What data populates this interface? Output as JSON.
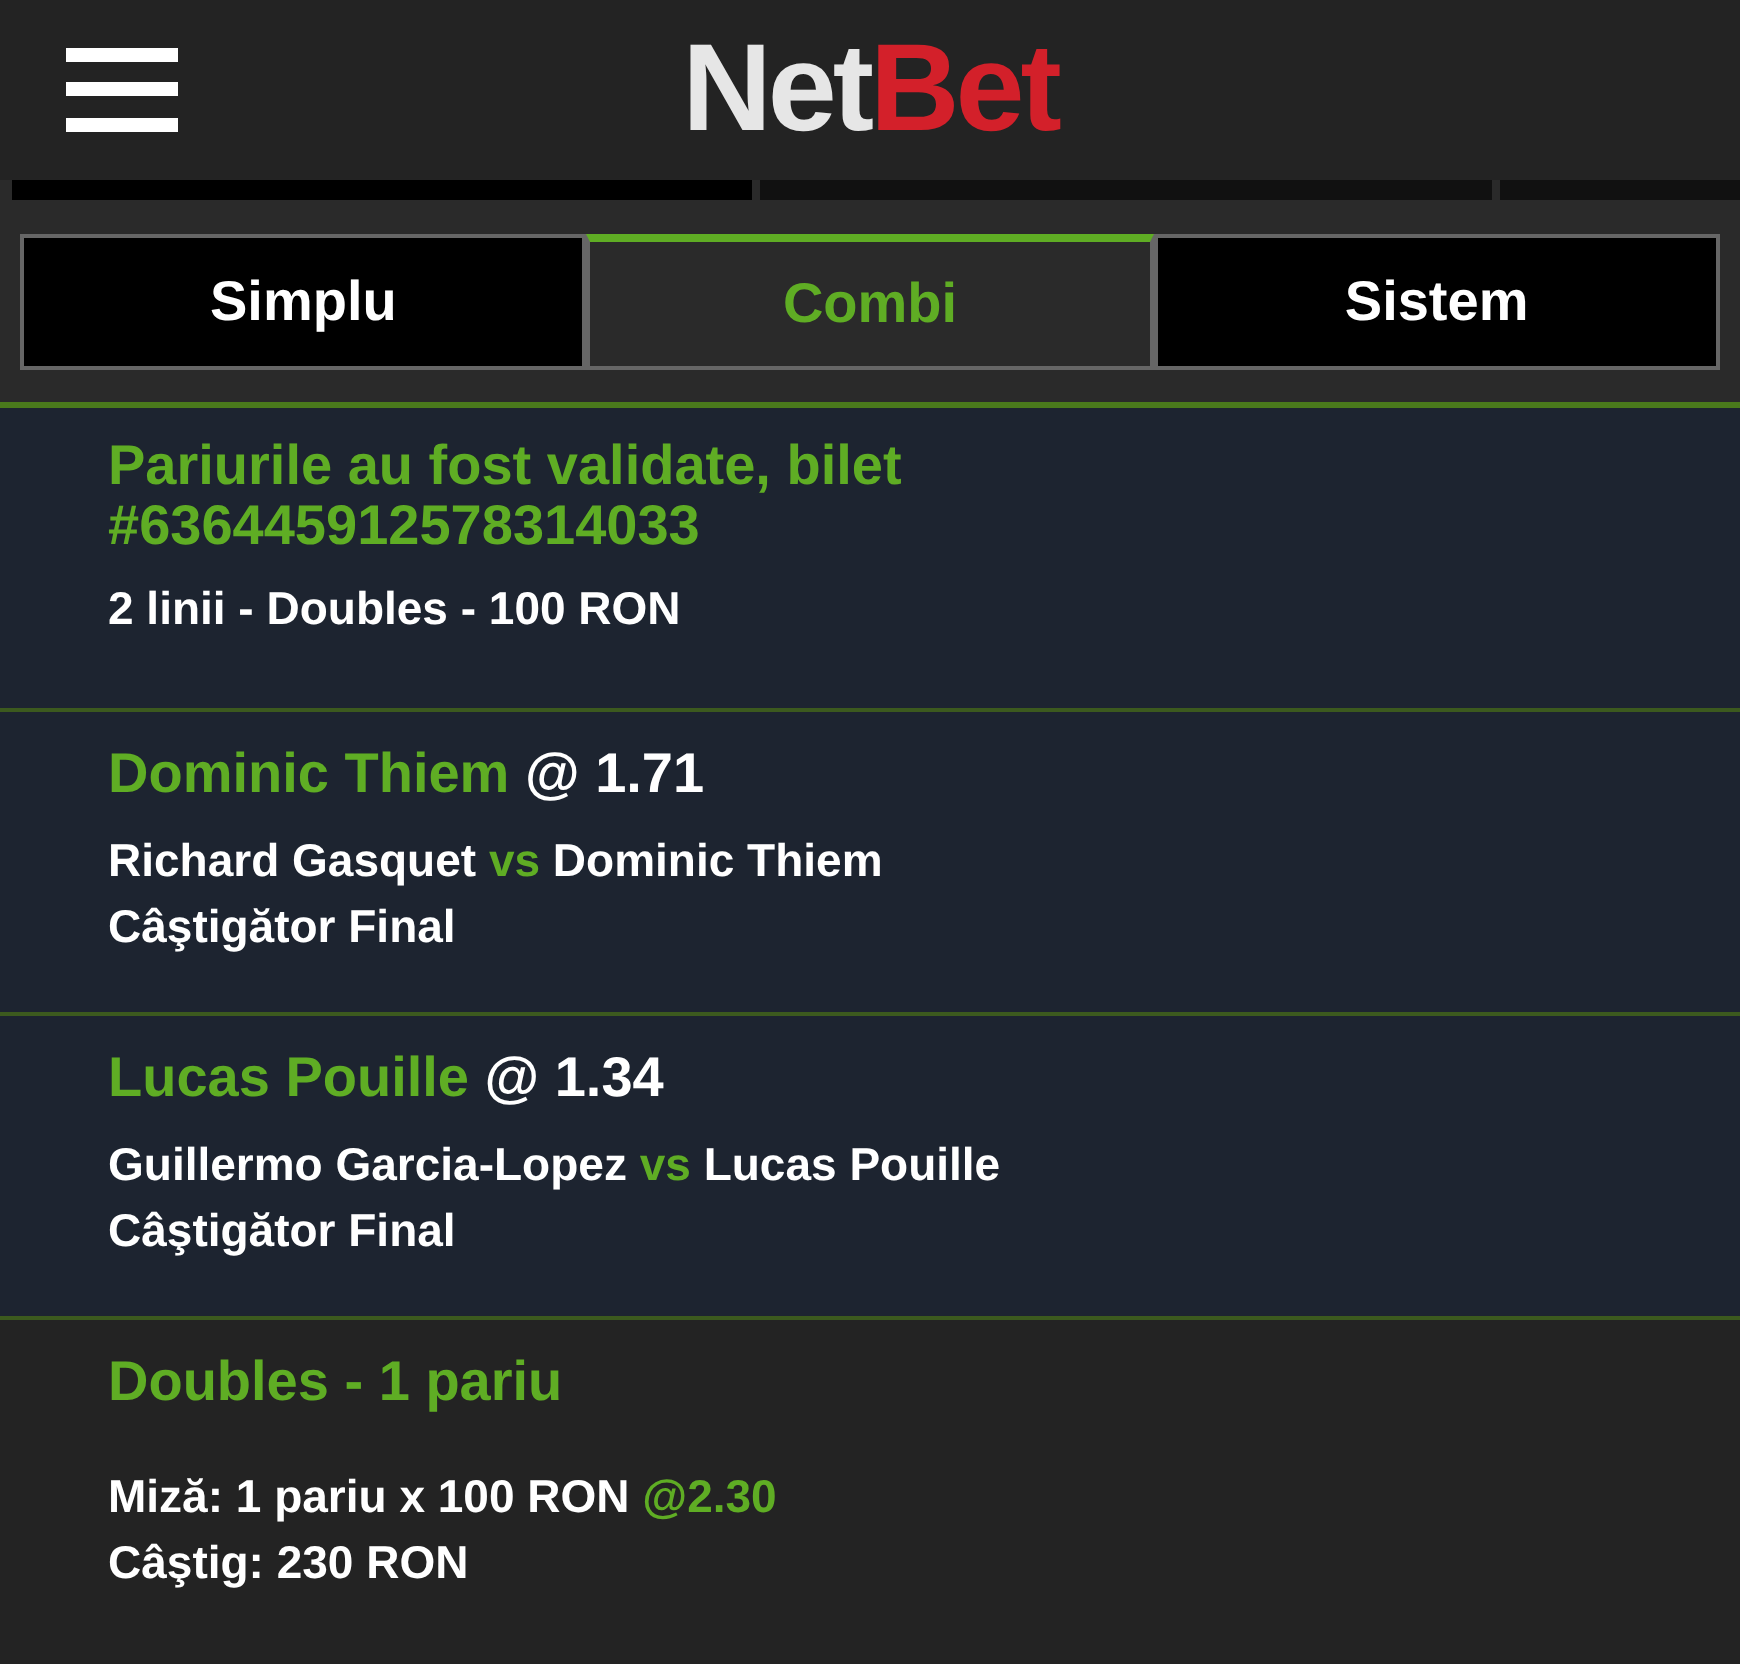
{
  "header": {
    "logo": {
      "left": "Net",
      "right": "Bet"
    }
  },
  "tabs": [
    {
      "label": "Simplu",
      "selected": false
    },
    {
      "label": "Combi",
      "selected": true
    },
    {
      "label": "Sistem",
      "selected": false
    }
  ],
  "receipt": {
    "title": "Pariurile au fost validate, bilet #636445912578314033",
    "summary": "2 linii - Doubles - 100 RON"
  },
  "selections": [
    {
      "pick": "Dominic Thiem",
      "odds": "@ 1.71",
      "home": "Richard Gasquet",
      "vs": "vs",
      "away": "Dominic Thiem",
      "market": "Câştigător Final"
    },
    {
      "pick": "Lucas Pouille",
      "odds": "@ 1.34",
      "home": "Guillermo Garcia-Lopez",
      "vs": "vs",
      "away": "Lucas Pouille",
      "market": "Câştigător Final"
    }
  ],
  "bet": {
    "title": "Doubles - 1 pariu",
    "stake": "Miză: 1 pariu x 100 RON",
    "stake_odds": "@2.30",
    "win": "Câştig: 230 RON"
  }
}
